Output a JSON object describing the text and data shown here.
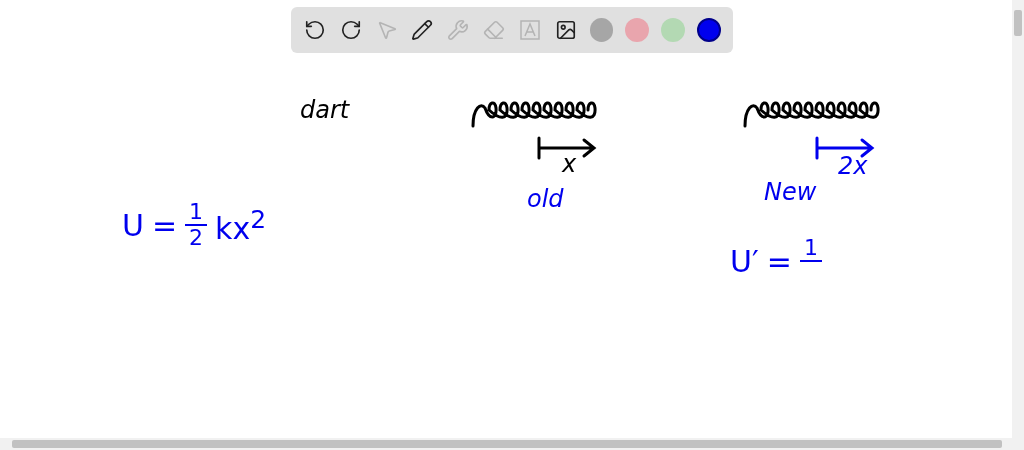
{
  "toolbar": {
    "tools": [
      {
        "kind": "undo",
        "disabled": false
      },
      {
        "kind": "redo",
        "disabled": false
      },
      {
        "kind": "select",
        "disabled": true
      },
      {
        "kind": "pen",
        "disabled": false
      },
      {
        "kind": "tools",
        "disabled": true
      },
      {
        "kind": "eraser",
        "disabled": true
      },
      {
        "kind": "text",
        "disabled": true
      },
      {
        "kind": "image",
        "disabled": false
      }
    ],
    "colors": [
      {
        "color": "#a6a6a6",
        "selected": false
      },
      {
        "color": "#e9a5ad",
        "selected": false
      },
      {
        "color": "#b3d9b3",
        "selected": false
      },
      {
        "color": "#0000ee",
        "selected": true
      }
    ]
  },
  "canvas": {
    "notes": [
      {
        "kind": "word",
        "text": "dart",
        "color": "#000000"
      },
      {
        "kind": "spring",
        "color": "#000000"
      },
      {
        "kind": "arrow",
        "color": "#000000"
      },
      {
        "kind": "word",
        "text": "x",
        "color": "#000000"
      },
      {
        "kind": "word",
        "text": "old",
        "color": "#0000ee"
      },
      {
        "kind": "equation",
        "lhs": "U",
        "eq": "=",
        "num": "1",
        "den": "2",
        "rest": "kx$^{2}$",
        "color": "#0000ee"
      },
      {
        "kind": "spring",
        "color": "#000000"
      },
      {
        "kind": "arrow",
        "color": "#0000ee"
      },
      {
        "kind": "word",
        "text": "2x",
        "color": "#0000ee"
      },
      {
        "kind": "word",
        "text": "New",
        "color": "#0000ee"
      },
      {
        "kind": "equation",
        "lhs": "U′",
        "eq": "=",
        "num": "1",
        "color": "#0000ee"
      }
    ]
  }
}
